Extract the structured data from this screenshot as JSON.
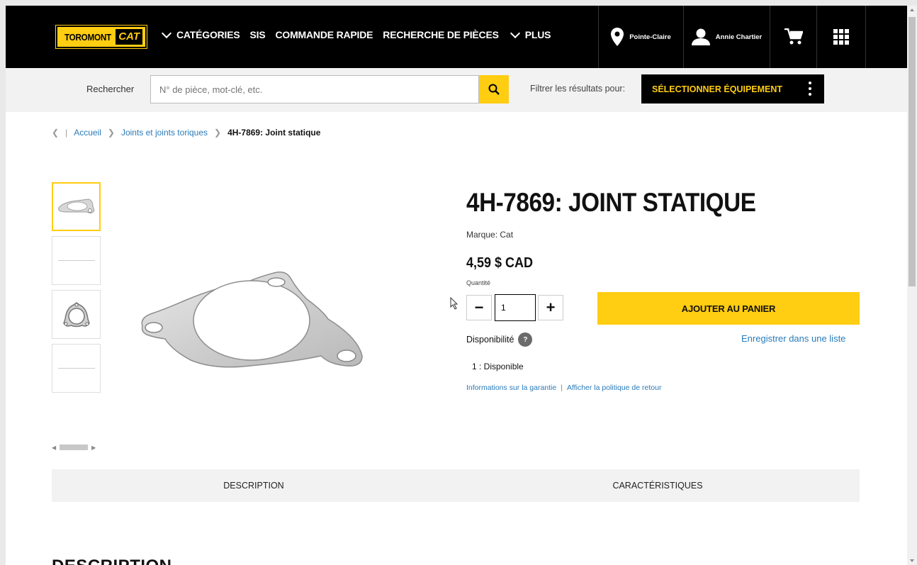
{
  "header": {
    "logo_text": "TOROMONT",
    "logo_cat": "CAT",
    "nav": [
      {
        "label": "CATÉGORIES",
        "chevron": true
      },
      {
        "label": "SIS",
        "chevron": false
      },
      {
        "label": "COMMANDE RAPIDE",
        "chevron": false
      },
      {
        "label": "RECHERCHE DE PIÈCES",
        "chevron": false
      },
      {
        "label": "PLUS",
        "chevron": true
      }
    ],
    "location": "Pointe-Claire",
    "user": "Annie Chartier"
  },
  "search": {
    "label": "Rechercher",
    "placeholder": "N° de pièce, mot-clé, etc.",
    "filter_label": "Filtrer les résultats pour:",
    "equipment_button": "SÉLECTIONNER ÉQUIPEMENT"
  },
  "breadcrumb": {
    "home": "Accueil",
    "category": "Joints et joints toriques",
    "current": "4H-7869: Joint statique"
  },
  "product": {
    "title": "4H-7869: JOINT STATIQUE",
    "brand": "Marque: Cat",
    "price": "4,59 $ CAD",
    "quantity_label": "Quantité",
    "quantity": "1",
    "add_to_cart": "AJOUTER AU PANIER",
    "availability_label": "Disponibilité",
    "save_to_list": "Enregistrer dans une liste",
    "stock": "1 : Disponible",
    "warranty_link": "Informations sur la garantie",
    "return_link": "Afficher la politique de retour"
  },
  "tabs": [
    {
      "label": "DESCRIPTION"
    },
    {
      "label": "CARACTÉRISTIQUES"
    }
  ],
  "section_title": "DESCRIPTION",
  "colors": {
    "brand_yellow": "#ffcd11",
    "header_black": "#000000",
    "link_blue": "#2a7bb8"
  }
}
